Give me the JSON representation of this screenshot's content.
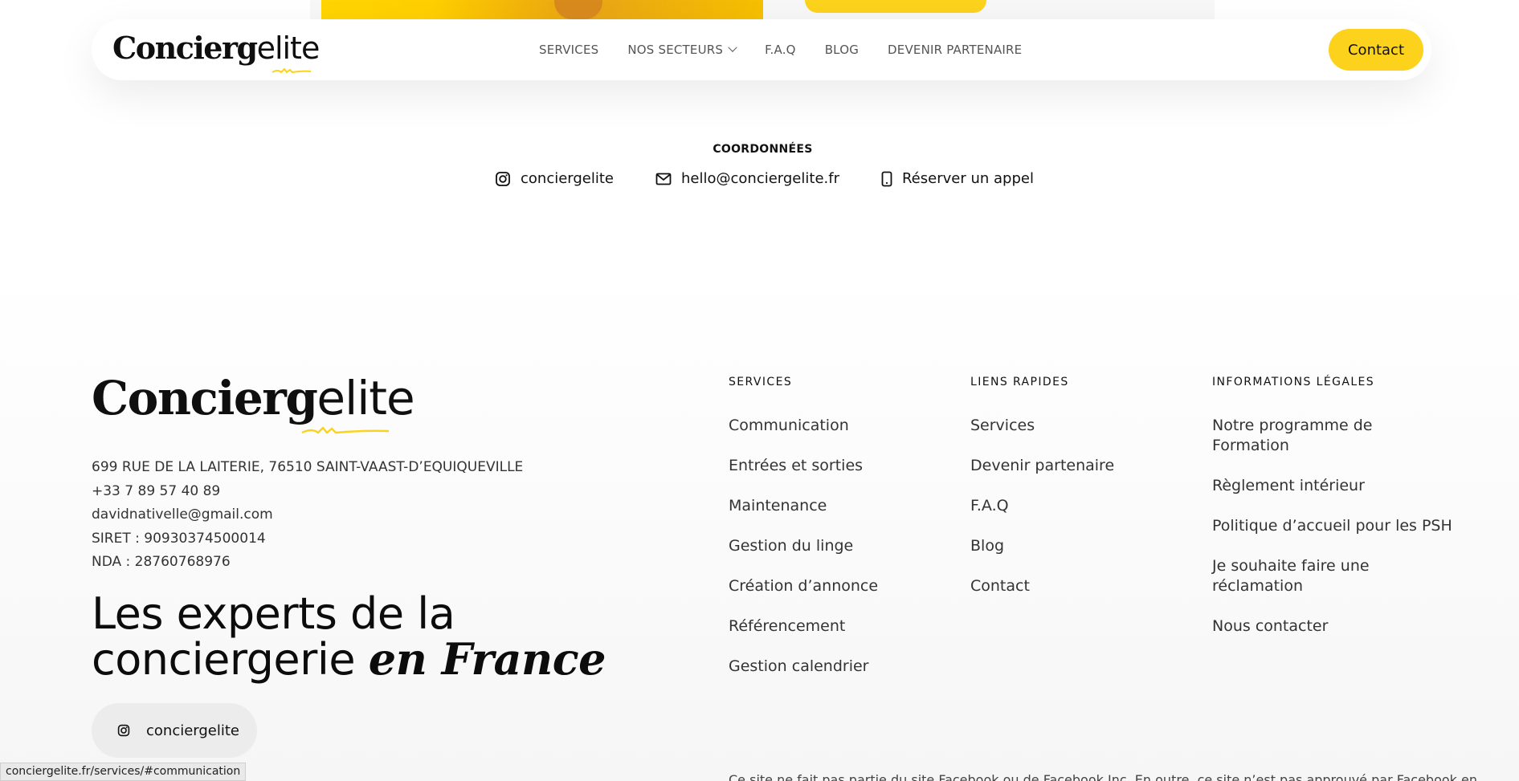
{
  "nav": {
    "logo": {
      "bold": "Concierg",
      "light": "elite"
    },
    "links": [
      "SERVICES",
      "NOS SECTEURS",
      "F.A.Q",
      "BLOG",
      "DEVENIR PARTENAIRE"
    ],
    "contact_label": "Contact"
  },
  "coordonnees": {
    "title": "COORDONNÉES",
    "instagram": "conciergelite",
    "email": "hello@conciergelite.fr",
    "call": "Réserver un appel"
  },
  "footer": {
    "logo": {
      "bold": "Concierg",
      "light": "elite"
    },
    "address": "699 RUE DE LA LAITERIE, 76510 SAINT-VAAST-D’EQUIQUEVILLE",
    "phone": "+33 7 89 57 40 89",
    "email": "davidnativelle@gmail.com",
    "siret": "SIRET : 90930374500014",
    "nda": "NDA : 28760768976",
    "tagline_line1": "Les experts de la",
    "tagline_line2_plain": "conciergerie",
    "tagline_line2_em": "en France",
    "instagram_label": "conciergelite",
    "columns": {
      "services": {
        "title": "SERVICES",
        "items": [
          "Communication",
          "Entrées et sorties",
          "Maintenance",
          "Gestion du linge",
          "Création d’annonce",
          "Référencement",
          "Gestion calendrier"
        ]
      },
      "liens": {
        "title": "LIENS RAPIDES",
        "items": [
          "Services",
          "Devenir partenaire",
          "F.A.Q",
          "Blog",
          "Contact"
        ]
      },
      "legal": {
        "title": "INFORMATIONS LÉGALES",
        "items": [
          "Notre programme de Formation",
          "Règlement intérieur",
          "Politique d’accueil pour les PSH",
          "Je souhaite faire une réclamation",
          "Nous contacter"
        ]
      }
    },
    "disclaimer": "Ce site ne fait pas partie du site Facebook ou de Facebook Inc. En outre, ce site n’est pas approuvé par Facebook en"
  },
  "status_bar": "conciergelite.fr/services/#communication",
  "colors": {
    "accent": "#fcd21d",
    "text": "#111111"
  }
}
